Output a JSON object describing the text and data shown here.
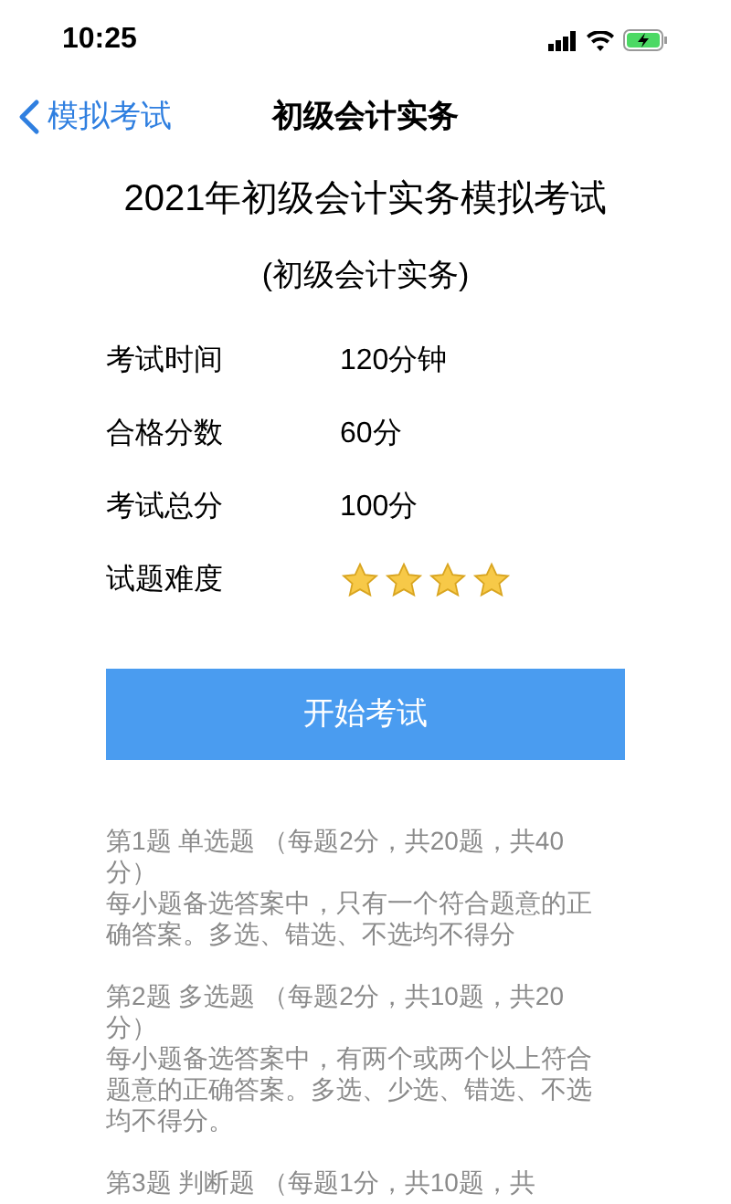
{
  "status_bar": {
    "time": "10:25"
  },
  "nav": {
    "back": "模拟考试",
    "title": "初级会计实务"
  },
  "exam": {
    "title": "2021年初级会计实务模拟考试",
    "subtitle": "(初级会计实务)"
  },
  "info": [
    {
      "label": "考试时间",
      "value": "120分钟"
    },
    {
      "label": "合格分数",
      "value": "60分"
    },
    {
      "label": "考试总分",
      "value": "100分"
    }
  ],
  "difficulty": {
    "label": "试题难度",
    "stars": 4
  },
  "start_button": "开始考试",
  "sections": [
    {
      "heading": "第1题 单选题 （每题2分，共20题，共40分）",
      "description": "每小题备选答案中，只有一个符合题意的正确答案。多选、错选、不选均不得分"
    },
    {
      "heading": "第2题 多选题 （每题2分，共10题，共20分）",
      "description": "每小题备选答案中，有两个或两个以上符合题意的正确答案。多选、少选、错选、不选均不得分。"
    },
    {
      "heading": "第3题 判断题 （每题1分，共10题，共"
    }
  ]
}
